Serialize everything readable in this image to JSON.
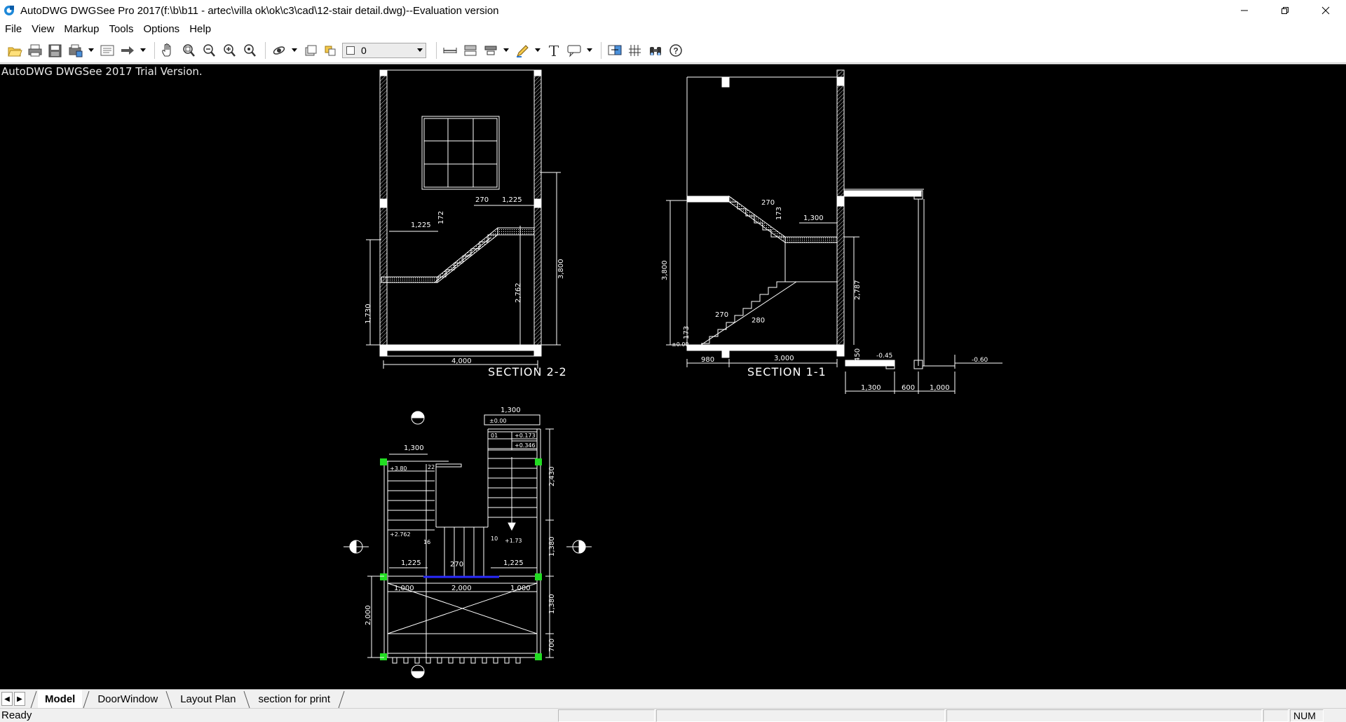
{
  "window": {
    "title": "AutoDWG DWGSee Pro 2017(f:\\b\\b11 - artec\\villa ok\\ok\\c3\\cad\\12-stair detail.dwg)--Evaluation version",
    "icon": "dwgsee-app-icon"
  },
  "menu": {
    "items": [
      {
        "label": "File"
      },
      {
        "label": "View"
      },
      {
        "label": "Markup"
      },
      {
        "label": "Tools"
      },
      {
        "label": "Options"
      },
      {
        "label": "Help"
      }
    ]
  },
  "toolbar": {
    "layer_value": "0",
    "icons": [
      "open-icon",
      "print-icon",
      "save-icon",
      "batch-print-icon",
      "layout-icon",
      "export-icon",
      "pan-icon",
      "zoom-window-icon",
      "zoom-out-icon",
      "zoom-in-icon",
      "zoom-extents-icon",
      "orbit-icon",
      "frame-icon",
      "layer-icon",
      "measure-icon",
      "dimension-icon",
      "align-icon",
      "pen-icon",
      "text-icon",
      "callout-icon",
      "compare-icon",
      "grid-icon",
      "binoculars-icon",
      "help-icon"
    ]
  },
  "canvas": {
    "trial_text": "AutoDWG DWGSee 2017 Trial Version.",
    "background": "#000000",
    "drawing": {
      "section22": {
        "title": "SECTION 2-2",
        "dims": [
          "270",
          "1,225",
          "172",
          "1,225",
          "3,800",
          "2,762",
          "1,730",
          "4,000"
        ]
      },
      "section11": {
        "title": "SECTION 1-1",
        "dims": [
          "270",
          "173",
          "1,300",
          "3,800",
          "2,787",
          "270",
          "280",
          "173",
          "±0.00",
          "980",
          "3,000",
          "450",
          "-0.45",
          "-0.60",
          "1,300",
          "600",
          "1,000"
        ]
      },
      "plan": {
        "dims": [
          "1,300",
          "±0.00",
          "01",
          "+0.173",
          "+0.346",
          "1,300",
          "+3.80",
          "22",
          "2,430",
          "+2.762",
          "16",
          "10",
          "+1.73",
          "1,380",
          "1,225",
          "270",
          "1,225",
          "1,000",
          "2,000",
          "1,000",
          "1,380",
          "2,000",
          "700"
        ]
      }
    }
  },
  "tabs": {
    "items": [
      {
        "label": "Model",
        "active": true
      },
      {
        "label": "DoorWindow",
        "active": false
      },
      {
        "label": "Layout Plan",
        "active": false
      },
      {
        "label": "section for print",
        "active": false
      }
    ]
  },
  "status": {
    "text": "Ready",
    "num": "NUM"
  },
  "colors": {
    "canvas_bg": "#000000",
    "line": "#ffffff",
    "grip_green": "#22dd22",
    "selection_blue": "#2a2aff"
  }
}
